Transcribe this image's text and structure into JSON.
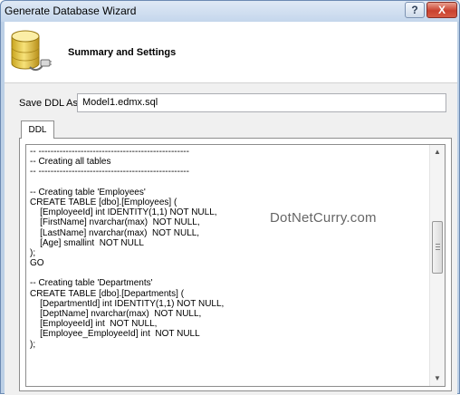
{
  "window": {
    "title": "Generate Database Wizard",
    "help_label": "?",
    "close_label": "X"
  },
  "header": {
    "title": "Summary and Settings",
    "icon": "database-icon"
  },
  "form": {
    "save_label": "Save DDL As:",
    "save_value": "Model1.edmx.sql"
  },
  "tabs": [
    {
      "label": "DDL",
      "selected": true
    }
  ],
  "code_lines": [
    "-- --------------------------------------------------",
    "-- Creating all tables",
    "-- --------------------------------------------------",
    "",
    "-- Creating table 'Employees'",
    "CREATE TABLE [dbo].[Employees] (",
    "    [EmployeeId] int IDENTITY(1,1) NOT NULL,",
    "    [FirstName] nvarchar(max)  NOT NULL,",
    "    [LastName] nvarchar(max)  NOT NULL,",
    "    [Age] smallint  NOT NULL",
    ");",
    "GO",
    "",
    "-- Creating table 'Departments'",
    "CREATE TABLE [dbo].[Departments] (",
    "    [DepartmentId] int IDENTITY(1,1) NOT NULL,",
    "    [DeptName] nvarchar(max)  NOT NULL,",
    "    [EmployeeId] int  NOT NULL,",
    "    [Employee_EmployeeId] int  NOT NULL",
    ");"
  ],
  "watermark": "DotNetCurry.com",
  "colors": {
    "title_bar": "#c4d6ec",
    "close_button": "#c9412f",
    "client_bg": "#f0f0f0"
  }
}
